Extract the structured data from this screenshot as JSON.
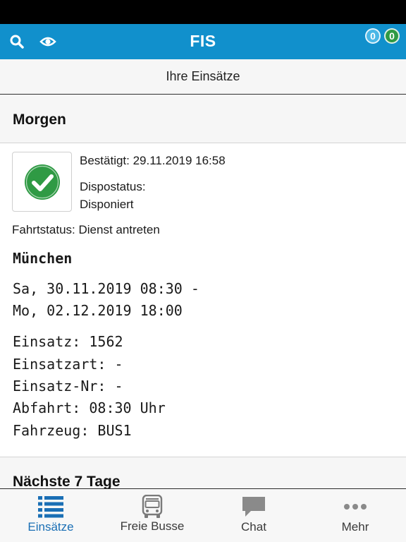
{
  "header": {
    "title": "FIS",
    "badge_blue": "0",
    "badge_green": "0",
    "search_icon": "search-icon",
    "eye_icon": "eye-icon"
  },
  "subheader": {
    "title": "Ihre Einsätze"
  },
  "sections": {
    "morgen": "Morgen",
    "next7": "Nächste 7 Tage"
  },
  "assignment": {
    "status_icon": "check-circle-icon",
    "confirmed": "Bestätigt: 29.11.2019 16:58",
    "dispo_label": "Dispostatus:",
    "dispo_value": "Disponiert",
    "fahrtstatus": "Fahrtstatus: Dienst antreten",
    "city": "München",
    "date_start": "Sa, 30.11.2019 08:30 -",
    "date_end": "Mo, 02.12.2019 18:00",
    "einsatz": "Einsatz: 1562",
    "einsatzart": "Einsatzart: -",
    "einsatz_nr": "Einsatz-Nr: -",
    "abfahrt": "Abfahrt: 08:30 Uhr",
    "fahrzeug": "Fahrzeug: BUS1"
  },
  "tabs": [
    {
      "label": "Einsätze",
      "icon": "list-icon",
      "active": true
    },
    {
      "label": "Freie Busse",
      "icon": "bus-icon",
      "active": false
    },
    {
      "label": "Chat",
      "icon": "chat-icon",
      "active": false
    },
    {
      "label": "Mehr",
      "icon": "more-icon",
      "active": false
    }
  ],
  "colors": {
    "appbar": "#1190cc",
    "active_tab": "#1a6fb5",
    "check_green": "#2f9a44",
    "badge_blue": "#49b7e6",
    "badge_green": "#2f9a44"
  }
}
